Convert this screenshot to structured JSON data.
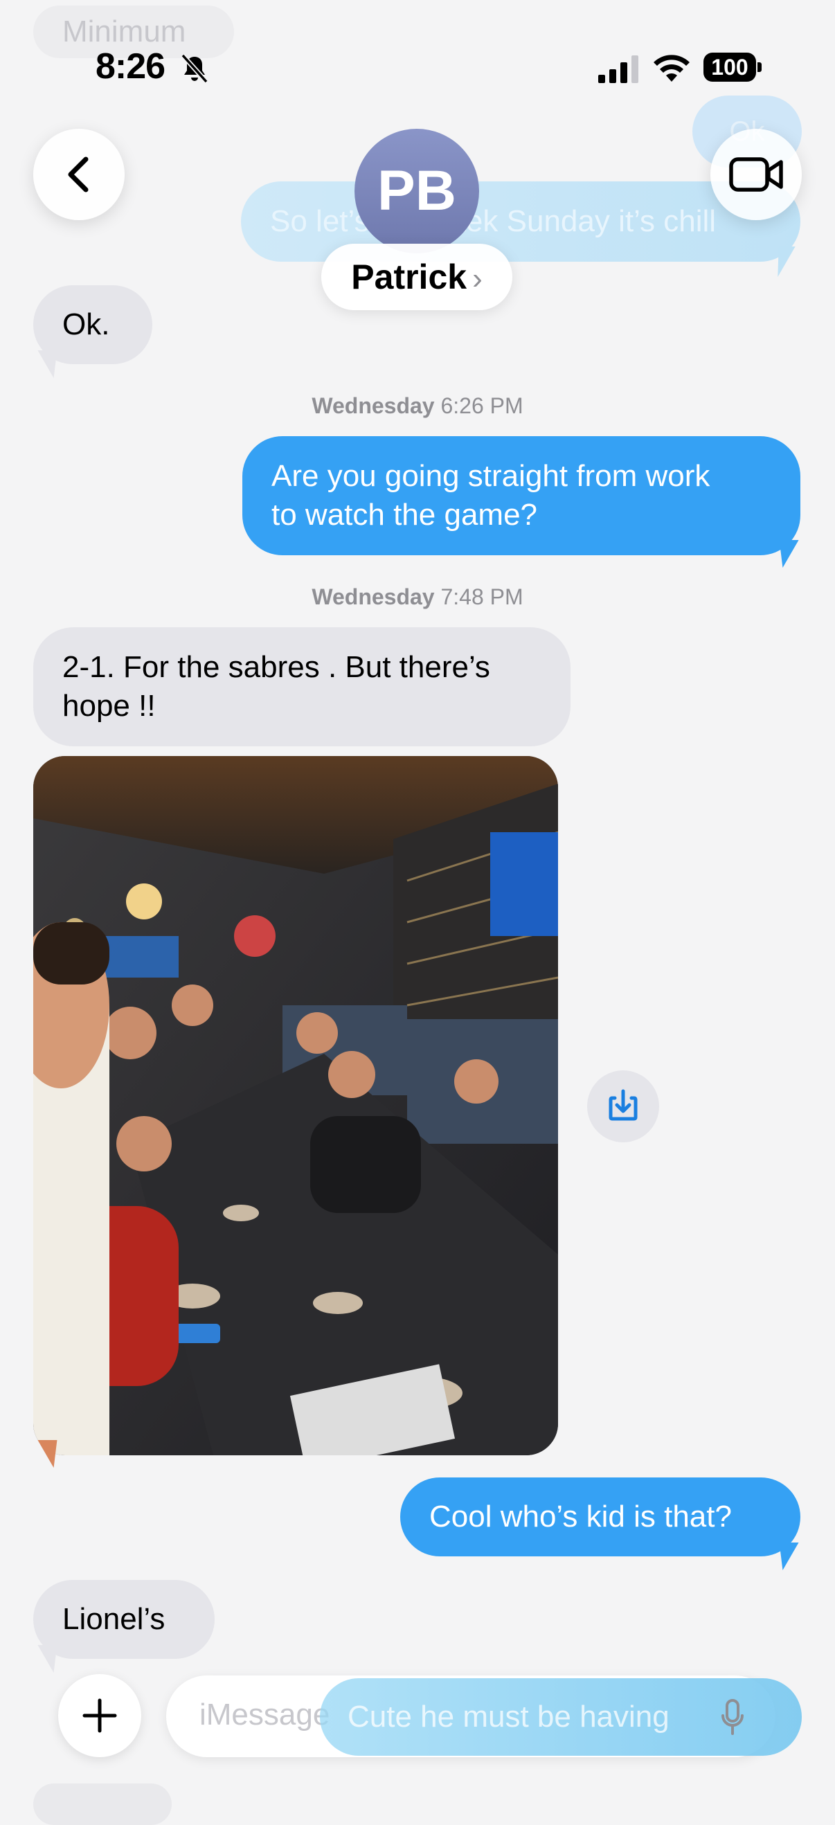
{
  "ghost": {
    "top_pill": "Minimum",
    "right_small": "Ok",
    "sent_preview": "So let’s do Potek Sunday it’s chill",
    "input_overlay": "Cute he must be having"
  },
  "status_bar": {
    "time": "8:26",
    "battery": "100"
  },
  "header": {
    "avatar_initials": "PB",
    "contact_name": "Patrick",
    "chevron": "›"
  },
  "messages": [
    {
      "type": "received",
      "text": "Ok."
    },
    {
      "type": "timestamp",
      "day": "Wednesday",
      "time": "6:26 PM"
    },
    {
      "type": "sent",
      "line1": "Are you going straight from work",
      "line2": "to watch the game?"
    },
    {
      "type": "timestamp",
      "day": "Wednesday",
      "time": "7:48 PM"
    },
    {
      "type": "received",
      "line1": "2-1. For the sabres . But there’s",
      "line2": "hope !!"
    },
    {
      "type": "sent",
      "text": "Cool who’s kid is that?"
    },
    {
      "type": "received",
      "text": "Lionel’s"
    }
  ],
  "composer": {
    "placeholder": "iMessage"
  },
  "colors": {
    "sent_bubble": "#35a1f4",
    "received_bubble": "#e5e5ea",
    "background": "#f4f4f5"
  },
  "icons": [
    "back-chevron-icon",
    "video-call-icon",
    "bell-slash-icon",
    "signal-icon",
    "wifi-icon",
    "battery-icon",
    "save-photo-icon",
    "plus-icon",
    "mic-icon"
  ]
}
